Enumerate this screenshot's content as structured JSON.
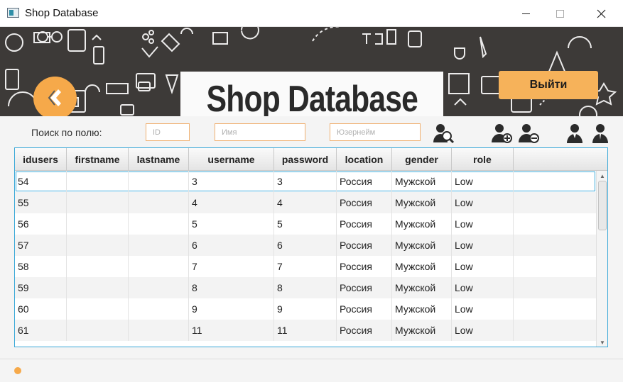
{
  "window": {
    "title": "Shop Database"
  },
  "header": {
    "logo_text": "Shop Database",
    "exit_label": "Выйти",
    "accent": "#f6a94a"
  },
  "search": {
    "label": "Поиск по полю:",
    "id_placeholder": "ID",
    "name_placeholder": "Имя",
    "username_placeholder": "Юзернейм"
  },
  "toolbar": {
    "icons": [
      "search-user-icon",
      "add-user-icon",
      "remove-user-icon",
      "user-icon",
      "admin-user-icon"
    ]
  },
  "table": {
    "columns": [
      "idusers",
      "firstname",
      "lastname",
      "username",
      "password",
      "location",
      "gender",
      "role"
    ],
    "rows": [
      [
        "54",
        "",
        "",
        "3",
        "3",
        "Россия",
        "Мужской",
        "Low"
      ],
      [
        "55",
        "",
        "",
        "4",
        "4",
        "Россия",
        "Мужской",
        "Low"
      ],
      [
        "56",
        "",
        "",
        "5",
        "5",
        "Россия",
        "Мужской",
        "Low"
      ],
      [
        "57",
        "",
        "",
        "6",
        "6",
        "Россия",
        "Мужской",
        "Low"
      ],
      [
        "58",
        "",
        "",
        "7",
        "7",
        "Россия",
        "Мужской",
        "Low"
      ],
      [
        "59",
        "",
        "",
        "8",
        "8",
        "Россия",
        "Мужской",
        "Low"
      ],
      [
        "60",
        "",
        "",
        "9",
        "9",
        "Россия",
        "Мужской",
        "Low"
      ],
      [
        "61",
        "",
        "",
        "11",
        "11",
        "Россия",
        "Мужской",
        "Low"
      ]
    ]
  }
}
